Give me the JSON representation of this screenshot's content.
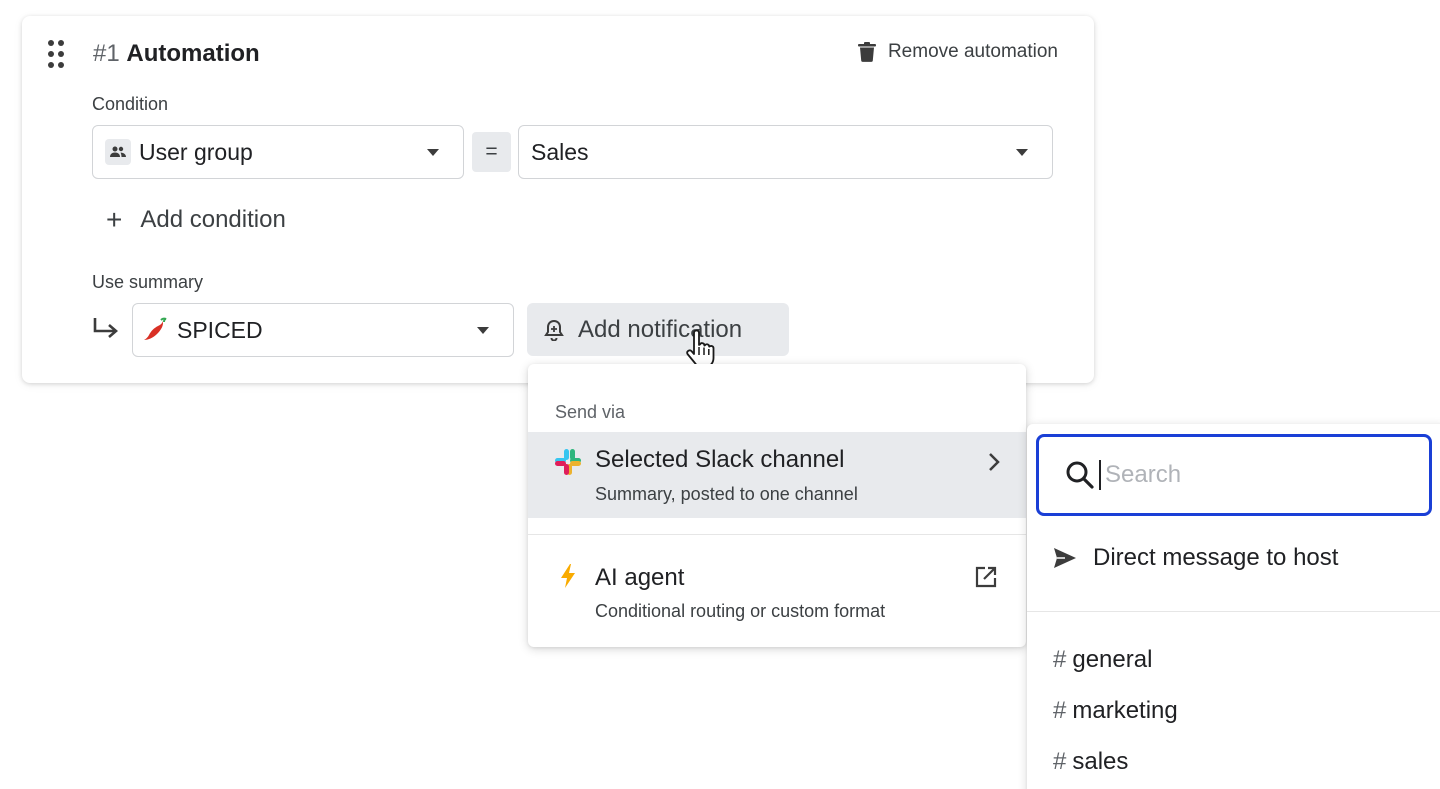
{
  "automation": {
    "number": "#1",
    "title": "Automation",
    "remove_label": "Remove automation",
    "condition_label": "Condition",
    "condition_field": "User group",
    "operator": "=",
    "condition_value": "Sales",
    "add_condition_label": "Add condition",
    "use_summary_label": "Use summary",
    "summary_value": "SPICED",
    "add_notification_label": "Add notification"
  },
  "send_menu": {
    "heading": "Send via",
    "items": [
      {
        "title": "Selected Slack channel",
        "subtitle": "Summary, posted to one channel",
        "icon": "slack-icon",
        "trailing": "chevron-right-icon"
      },
      {
        "title": "AI agent",
        "subtitle": "Conditional routing or custom format",
        "icon": "lightning-icon",
        "trailing": "external-link-icon"
      }
    ]
  },
  "channel_panel": {
    "search_placeholder": "Search",
    "direct_message_label": "Direct message to host",
    "channels": [
      "general",
      "marketing",
      "sales"
    ]
  },
  "colors": {
    "focus_border": "#1a3fd6",
    "lightning": "#f9ab00",
    "chili": "#d93025",
    "hover_bg": "#e8eaed"
  }
}
